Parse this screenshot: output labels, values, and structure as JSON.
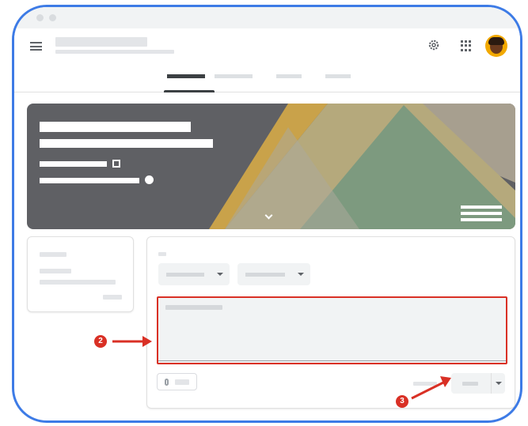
{
  "window": {
    "title": ""
  },
  "header": {
    "title": "",
    "subtitle": "",
    "icons": {
      "menu": "menu-icon",
      "settings": "gear-icon",
      "apps": "apps-grid-icon",
      "account": "avatar"
    }
  },
  "tabs": [
    {
      "label": "",
      "active": true
    },
    {
      "label": "",
      "active": false
    },
    {
      "label": "",
      "active": false
    },
    {
      "label": "",
      "active": false
    }
  ],
  "banner": {
    "class_name": "",
    "section": "",
    "class_code": "",
    "meet_link": "",
    "colors": {
      "base": "#5f6064",
      "gold": "#c9a24a",
      "green": "#7d9a7f",
      "beige": "#a79f8f"
    }
  },
  "upcoming": {
    "title": "",
    "body": "",
    "view_all": ""
  },
  "composer": {
    "for_label": "",
    "class_select": "",
    "students_select": "",
    "placeholder": "",
    "attach_label": "",
    "cancel_label": "",
    "post_label": ""
  },
  "annotations": [
    {
      "label": "2",
      "color": "#d93025"
    },
    {
      "label": "3",
      "color": "#d93025"
    }
  ],
  "accent": "#3d7be6"
}
